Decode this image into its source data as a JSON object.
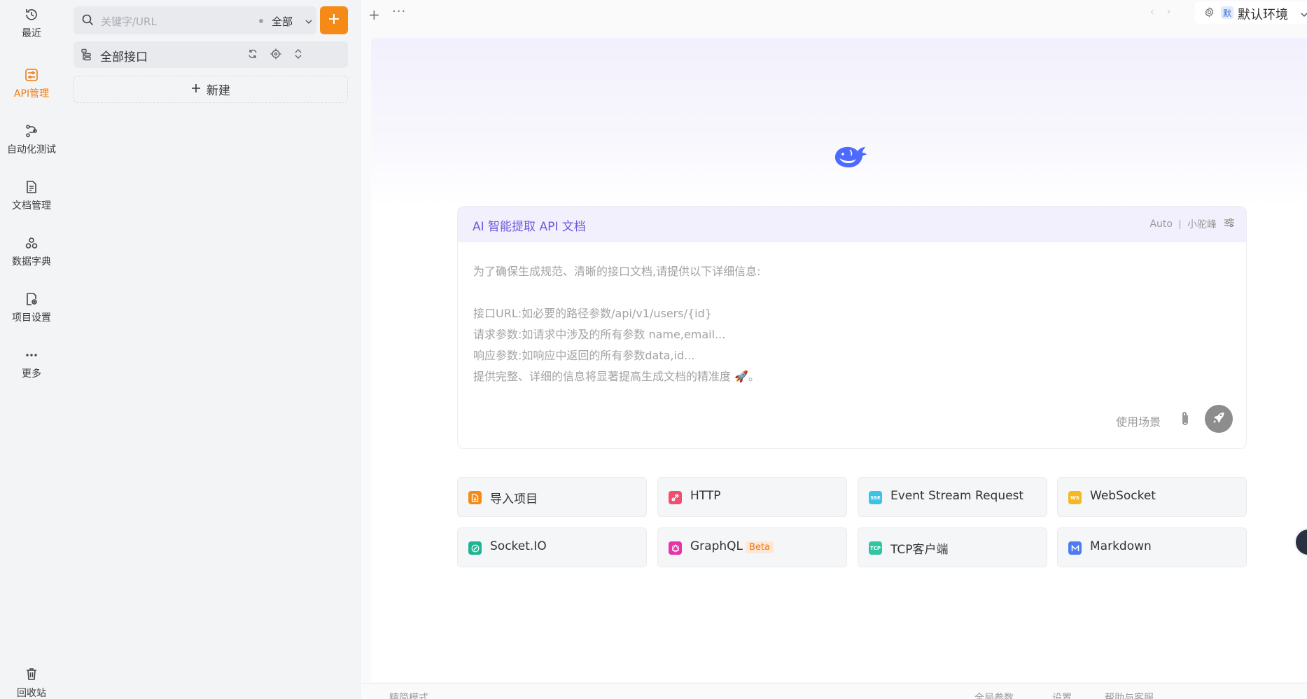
{
  "nav": {
    "items": [
      {
        "label": "最近",
        "icon": "history-icon"
      },
      {
        "label": "API管理",
        "icon": "api-management-icon"
      },
      {
        "label": "自动化测试",
        "icon": "automation-icon"
      },
      {
        "label": "文档管理",
        "icon": "document-icon"
      },
      {
        "label": "数据字典",
        "icon": "data-dictionary-icon"
      },
      {
        "label": "项目设置",
        "icon": "project-settings-icon"
      },
      {
        "label": "更多",
        "icon": "more-icon"
      }
    ],
    "recycle_label": "回收站",
    "active_color": "#f07a12"
  },
  "tree": {
    "search_placeholder": "关键字/URL",
    "filter_value": "全部",
    "all_interfaces_label": "全部接口",
    "new_label": "新建"
  },
  "topbar": {
    "env_badge": "默",
    "env_name": "默认环境"
  },
  "ai": {
    "title": "AI 智能提取 API 文档",
    "mode": "Auto",
    "model": "小驼峰",
    "prompt_lines": [
      "为了确保生成规范、清晰的接口文档,请提供以下详细信息:",
      "",
      "接口URL:如必要的路径参数/api/v1/users/{id}",
      "请求参数:如请求中涉及的所有参数 name,email...",
      "响应参数:如响应中返回的所有参数data,id...",
      "提供完整、详细的信息将显著提高生成文档的精准度 🚀。"
    ],
    "scene_label": "使用场景",
    "accent_color": "#6b5ad9"
  },
  "quick_actions": [
    {
      "label": "导入项目",
      "icon": "import-icon",
      "color": "#f58b16",
      "tag": ""
    },
    {
      "label": "HTTP",
      "icon": "http-icon",
      "color": "#f0506e",
      "tag": ""
    },
    {
      "label": "Event Stream Request",
      "icon": "sse-icon",
      "color": "#3bc3e6",
      "tag": "SSE"
    },
    {
      "label": "WebSocket",
      "icon": "websocket-icon",
      "color": "#f6b820",
      "tag": "WS"
    },
    {
      "label": "Socket.IO",
      "icon": "socketio-icon",
      "color": "#20b592",
      "tag": ""
    },
    {
      "label": "GraphQL",
      "icon": "graphql-icon",
      "color": "#e535ab",
      "tag": "",
      "badge": "Beta"
    },
    {
      "label": "TCP客户端",
      "icon": "tcp-icon",
      "color": "#2fc6a3",
      "tag": "TCP"
    },
    {
      "label": "Markdown",
      "icon": "markdown-icon",
      "color": "#4f7cf0",
      "tag": ""
    }
  ],
  "footer": {
    "left": "精简模式",
    "global_params": "全局参数",
    "settings": "设置",
    "help": "帮助与客服"
  },
  "brand_color": "#f58b16"
}
